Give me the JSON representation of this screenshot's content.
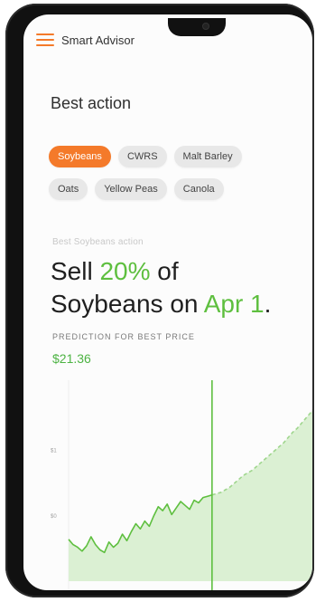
{
  "app": {
    "title": "Smart Advisor"
  },
  "page": {
    "section_title": "Best action"
  },
  "chips": {
    "row1": [
      "Soybeans",
      "CWRS",
      "Malt Barley"
    ],
    "row2": [
      "Oats",
      "Yellow Peas",
      "Canola"
    ],
    "active": "Soybeans"
  },
  "recommendation": {
    "label": "Best Soybeans action",
    "line1_prefix": "Sell ",
    "percent": "20%",
    "line1_suffix": " of",
    "line2_prefix": "Soybeans on ",
    "date": "Apr 1",
    "line2_suffix": "."
  },
  "prediction": {
    "label": "PREDICTION FOR BEST PRICE",
    "price": "$21.36"
  },
  "colors": {
    "accent_orange": "#f47a2a",
    "accent_green": "#5ebf3f",
    "chart_fill": "#d9efd1"
  },
  "chart_data": {
    "type": "area",
    "y_ticks": [
      "$1",
      "$0"
    ],
    "series": [
      {
        "values": [
          0.32,
          0.28,
          0.26,
          0.23,
          0.27,
          0.34,
          0.28,
          0.24,
          0.22,
          0.3,
          0.26,
          0.29,
          0.36,
          0.31,
          0.38,
          0.44,
          0.4,
          0.46,
          0.42,
          0.5,
          0.57,
          0.54,
          0.59,
          0.51,
          0.56,
          0.61,
          0.58,
          0.55,
          0.62,
          0.6,
          0.64,
          0.65,
          0.66,
          0.67,
          0.68,
          0.7,
          0.72,
          0.75,
          0.78,
          0.81,
          0.83,
          0.85,
          0.88,
          0.91,
          0.94,
          0.97,
          1.0,
          1.03,
          1.06,
          1.1,
          1.14,
          1.17,
          1.21,
          1.25,
          1.29,
          1.33,
          1.37
        ]
      }
    ],
    "vertical_marker_index": 32,
    "ylim": [
      0,
      1.4
    ]
  }
}
